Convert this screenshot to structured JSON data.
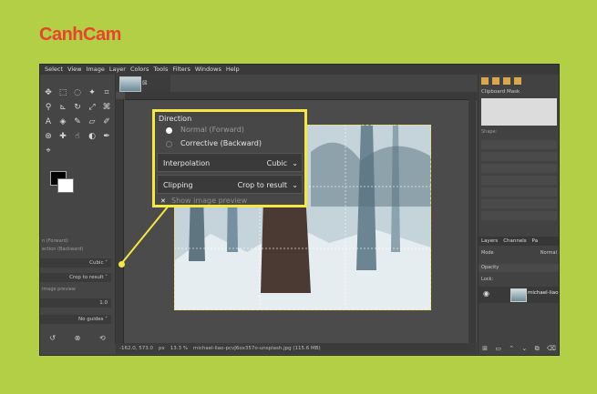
{
  "brand": {
    "name": "CanhCam",
    "color": "#e8442d"
  },
  "accent": "#f6e742",
  "menu": [
    "Select",
    "View",
    "Image",
    "Layer",
    "Colors",
    "Tools",
    "Filters",
    "Windows",
    "Help"
  ],
  "tool_options": {
    "direction_label": "n (Forward)",
    "direction_alt": "ection (Backward)",
    "interpolation_value": "Cubic",
    "clipping_value": "Crop to result",
    "preview_label": "image preview",
    "value_label": "1.0",
    "guides_value": "No guides"
  },
  "callout": {
    "direction_title": "Direction",
    "option_forward": "Normal (Forward)",
    "option_backward": "Corrective (Backward)",
    "interpolation_label": "Interpolation",
    "interpolation_value": "Cubic",
    "clipping_label": "Clipping",
    "clipping_value": "Crop to result",
    "show_preview_label": "Show image preview"
  },
  "status": {
    "coords": "-162.0, 573.0",
    "unit": "px",
    "zoom": "13.3 %",
    "filename": "michael-liao-pcvJ6ox357o-unsplash.jpg (115.6 MB)"
  },
  "dock": {
    "clipboard_title": "Clipboard Mask",
    "shapes_label": "Shape:",
    "tab_layers": "Layers",
    "tab_channels": "Channels",
    "tab_paths": "Pa",
    "mode_label": "Mode",
    "mode_value": "Normal",
    "opacity_label": "Opacity",
    "lock_label": "Lock:",
    "layer_name": "michael-liao"
  }
}
